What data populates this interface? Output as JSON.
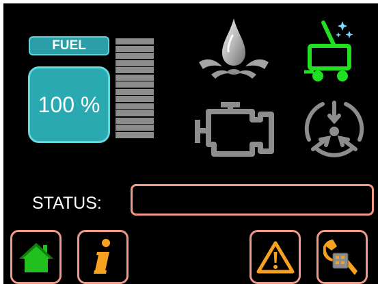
{
  "fuel": {
    "label": "FUEL",
    "percent_text": "100 %",
    "level": 1.0,
    "segments": 14
  },
  "status": {
    "label": "STATUS:",
    "value": ""
  },
  "icons": {
    "oil": "oil-drop-icon",
    "cleaning": "cleaning-machine-icon",
    "engine": "check-engine-icon",
    "service": "service-sensor-icon",
    "home": "home-icon",
    "info": "info-icon",
    "warning": "warning-icon",
    "settings": "wrench-settings-icon"
  },
  "colors": {
    "background": "#000000",
    "accent_teal": "#2aa9b0",
    "button_border": "#f19a88",
    "home_green": "#22c01e",
    "cleaning_green": "#21e021",
    "orange": "#f6a11f",
    "inactive_gray": "#8d8d8d"
  }
}
